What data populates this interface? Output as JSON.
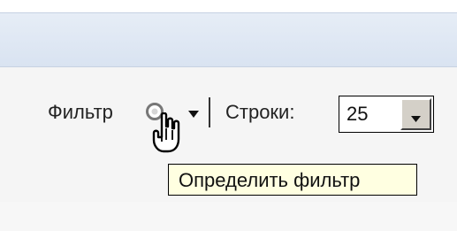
{
  "toolbar": {
    "filter_label": "Фильтр",
    "rows_label": "Строки:",
    "rows_value": "25"
  },
  "tooltip": {
    "text": "Определить фильтр"
  },
  "icons": {
    "filter": "filter-icon",
    "dropdown": "chevron-down-icon",
    "cursor": "hand-pointer-cursor"
  },
  "colors": {
    "top_band": "#d9e3f1",
    "tooltip_bg": "#ffffe1",
    "toolbar_line": "#3a516f"
  }
}
